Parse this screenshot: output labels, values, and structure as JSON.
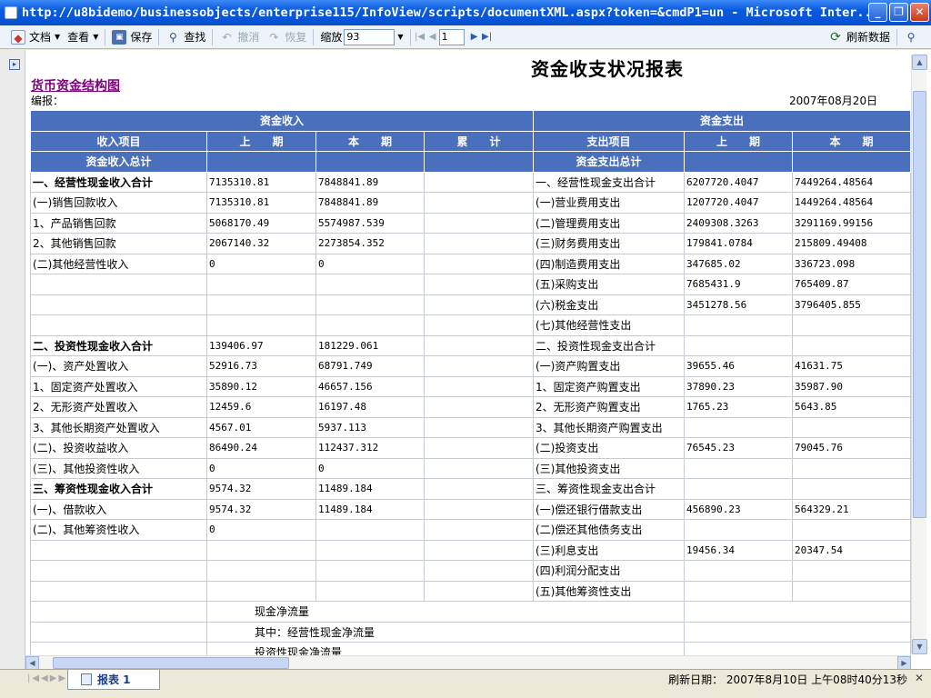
{
  "window": {
    "title": "http://u8bidemo/businessobjects/enterprise115/InfoView/scripts/documentXML.aspx?token=&cmdP1=un - Microsoft Inter..."
  },
  "toolbar": {
    "document_label": "文档",
    "view_label": "查看",
    "save_label": "保存",
    "find_label": "查找",
    "undo_label": "撤消",
    "redo_label": "恢复",
    "zoom_label": "缩放",
    "zoom_value": "93",
    "page_value": "1",
    "refresh_label": "刷新数据"
  },
  "report": {
    "title": "资金收支状况报表",
    "link": "货币资金结构图",
    "editor_label": "编报：",
    "date": "2007年08月20日",
    "header": {
      "income_group": "资金收入",
      "expense_group": "资金支出",
      "col_income_item": "收入项目",
      "col_prev": "上　　期",
      "col_curr": "本　　期",
      "col_cum": "累　　计",
      "col_expense_item": "支出项目",
      "col_prev2": "上　　期",
      "col_curr2": "本　　期",
      "income_total": "资金收入总计",
      "expense_total": "资金支出总计"
    },
    "rows": [
      {
        "in_item": "一、经营性现金收入合计",
        "in_bold": true,
        "in_prev": "7135310.81",
        "in_curr": "7848841.89",
        "in_cum": "",
        "out_item": "一、经营性现金支出合计",
        "out_prev": "6207720.4047",
        "out_curr": "7449264.48564"
      },
      {
        "in_item": "(一)销售回款收入",
        "in_prev": "7135310.81",
        "in_curr": "7848841.89",
        "in_cum": "",
        "out_item": "(一)营业费用支出",
        "out_prev": "1207720.4047",
        "out_curr": "1449264.48564"
      },
      {
        "in_item": "1、产品销售回款",
        "in_prev": "5068170.49",
        "in_curr": "5574987.539",
        "in_cum": "",
        "out_item": "(二)管理费用支出",
        "out_prev": "2409308.3263",
        "out_curr": "3291169.99156"
      },
      {
        "in_item": "2、其他销售回款",
        "in_prev": "2067140.32",
        "in_curr": "2273854.352",
        "in_cum": "",
        "out_item": "(三)财务费用支出",
        "out_prev": "179841.0784",
        "out_curr": "215809.49408"
      },
      {
        "in_item": "(二)其他经营性收入",
        "in_prev": "0",
        "in_curr": "0",
        "in_cum": "",
        "out_item": "(四)制造费用支出",
        "out_prev": "347685.02",
        "out_curr": "336723.098"
      },
      {
        "in_item": "",
        "in_prev": "",
        "in_curr": "",
        "in_cum": "",
        "out_item": "(五)采购支出",
        "out_prev": "7685431.9",
        "out_curr": "765409.87"
      },
      {
        "in_item": "",
        "in_prev": "",
        "in_curr": "",
        "in_cum": "",
        "out_item": "(六)税金支出",
        "out_prev": "3451278.56",
        "out_curr": "3796405.855"
      },
      {
        "in_item": "",
        "in_prev": "",
        "in_curr": "",
        "in_cum": "",
        "out_item": "(七)其他经营性支出",
        "out_prev": "",
        "out_curr": ""
      },
      {
        "in_item": "二、投资性现金收入合计",
        "in_bold": true,
        "in_prev": "139406.97",
        "in_curr": "181229.061",
        "in_cum": "",
        "out_item": "二、投资性现金支出合计",
        "out_prev": "",
        "out_curr": ""
      },
      {
        "in_item": "(一)、资产处置收入",
        "in_prev": "52916.73",
        "in_curr": "68791.749",
        "in_cum": "",
        "out_item": "(一)资产购置支出",
        "out_prev": "39655.46",
        "out_curr": "41631.75"
      },
      {
        "in_item": "1、固定资产处置收入",
        "in_prev": "35890.12",
        "in_curr": "46657.156",
        "in_cum": "",
        "out_item": "1、固定资产购置支出",
        "out_prev": "37890.23",
        "out_curr": "35987.90"
      },
      {
        "in_item": "2、无形资产处置收入",
        "in_prev": "12459.6",
        "in_curr": "16197.48",
        "in_cum": "",
        "out_item": "2、无形资产购置支出",
        "out_prev": "1765.23",
        "out_curr": "5643.85"
      },
      {
        "in_item": "3、其他长期资产处置收入",
        "in_prev": "4567.01",
        "in_curr": "5937.113",
        "in_cum": "",
        "out_item": "3、其他长期资产购置支出",
        "out_prev": "",
        "out_curr": ""
      },
      {
        "in_item": "(二)、投资收益收入",
        "in_prev": "86490.24",
        "in_curr": "112437.312",
        "in_cum": "",
        "out_item": "(二)投资支出",
        "out_prev": "76545.23",
        "out_curr": "79045.76"
      },
      {
        "in_item": "(三)、其他投资性收入",
        "in_prev": "0",
        "in_curr": "0",
        "in_cum": "",
        "out_item": "(三)其他投资支出",
        "out_prev": "",
        "out_curr": ""
      },
      {
        "in_item": "三、筹资性现金收入合计",
        "in_bold": true,
        "in_prev": "9574.32",
        "in_curr": "11489.184",
        "in_cum": "",
        "out_item": "三、筹资性现金支出合计",
        "out_prev": "",
        "out_curr": ""
      },
      {
        "in_item": "(一)、借款收入",
        "in_prev": "9574.32",
        "in_curr": "11489.184",
        "in_cum": "",
        "out_item": "(一)偿还银行借款支出",
        "out_prev": "456890.23",
        "out_curr": "564329.21"
      },
      {
        "in_item": "(二)、其他筹资性收入",
        "in_prev": "0",
        "in_curr": "",
        "in_cum": "",
        "out_item": "(二)偿还其他债务支出",
        "out_prev": "",
        "out_curr": ""
      },
      {
        "in_item": "",
        "in_prev": "",
        "in_curr": "",
        "in_cum": "",
        "out_item": "(三)利息支出",
        "out_prev": "19456.34",
        "out_curr": "20347.54"
      },
      {
        "in_item": "",
        "in_prev": "",
        "in_curr": "",
        "in_cum": "",
        "out_item": "(四)利润分配支出",
        "out_prev": "",
        "out_curr": ""
      },
      {
        "in_item": "",
        "in_prev": "",
        "in_curr": "",
        "in_cum": "",
        "out_item": "(五)其他筹资性支出",
        "out_prev": "",
        "out_curr": ""
      }
    ],
    "net_flows": [
      "现金净流量",
      "其中：经营性现金净流量",
      "投资性现金净流量"
    ]
  },
  "bottom": {
    "sheet_tab": "报表 1",
    "refresh_status": "刷新日期： 2007年8月10日 上午08时40分13秒"
  }
}
